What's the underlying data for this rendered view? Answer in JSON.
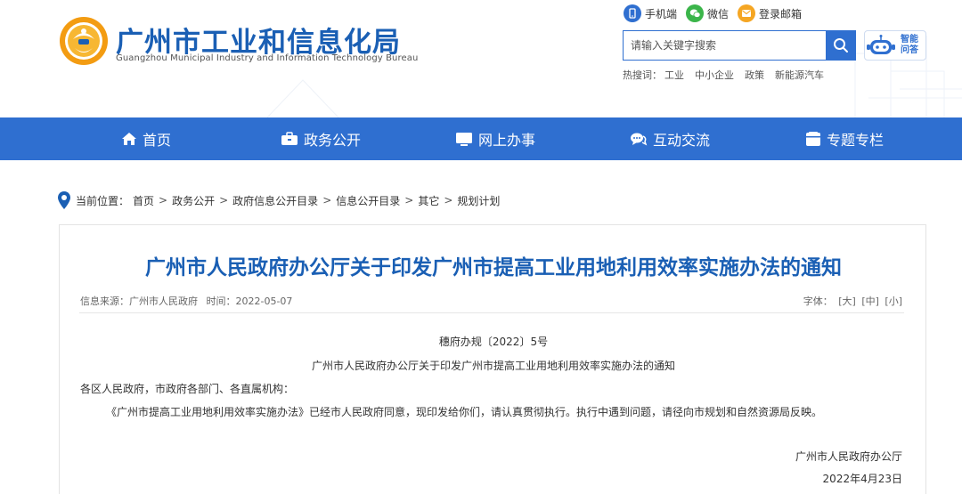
{
  "header": {
    "site_title": "广州市工业和信息化局",
    "site_subtitle": "Guangzhou Municipal Industry and Information Technology Bureau",
    "quick_links": [
      {
        "label": "手机端",
        "icon": "mobile-icon",
        "color": "#2f6fd0"
      },
      {
        "label": "微信",
        "icon": "wechat-icon",
        "color": "#3bb54a"
      },
      {
        "label": "登录邮箱",
        "icon": "mail-icon",
        "color": "#f5a623"
      }
    ],
    "search": {
      "placeholder": "请输入关键字搜索"
    },
    "robot_label": "智能问答",
    "hot": {
      "label": "热搜词：",
      "keywords": [
        "工业",
        "中小企业",
        "政策",
        "新能源汽车"
      ]
    }
  },
  "nav": {
    "items": [
      {
        "label": "首页",
        "icon": "home-icon"
      },
      {
        "label": "政务公开",
        "icon": "briefcase-icon"
      },
      {
        "label": "网上办事",
        "icon": "monitor-icon"
      },
      {
        "label": "互动交流",
        "icon": "chat-icon"
      },
      {
        "label": "专题专栏",
        "icon": "folder-icon"
      }
    ]
  },
  "breadcrumb": {
    "label": "当前位置：",
    "items": [
      "首页",
      "政务公开",
      "政府信息公开目录",
      "信息公开目录",
      "其它",
      "规划计划"
    ],
    "separator": ">"
  },
  "article": {
    "title": "广州市人民政府办公厅关于印发广州市提高工业用地利用效率实施办法的通知",
    "source": "信息来源：广州市人民政府",
    "time": "时间：2022-05-07",
    "font_label": "字体：",
    "font_sizes": [
      "[大]",
      "[中]",
      "[小]"
    ],
    "doc_no": "穗府办规〔2022〕5号",
    "doc_title": "广州市人民政府办公厅关于印发广州市提高工业用地利用效率实施办法的通知",
    "salutation": "各区人民政府，市政府各部门、各直属机构：",
    "body": "《广州市提高工业用地利用效率实施办法》已经市人民政府同意，现印发给你们，请认真贯彻执行。执行中遇到问题，请径向市规划和自然资源局反映。",
    "signature": "广州市人民政府办公厅",
    "date": "2022年4月23日"
  },
  "colors": {
    "primary": "#2f6fd0",
    "title_blue": "#1a5fb4",
    "logo_orange": "#f39c12"
  }
}
